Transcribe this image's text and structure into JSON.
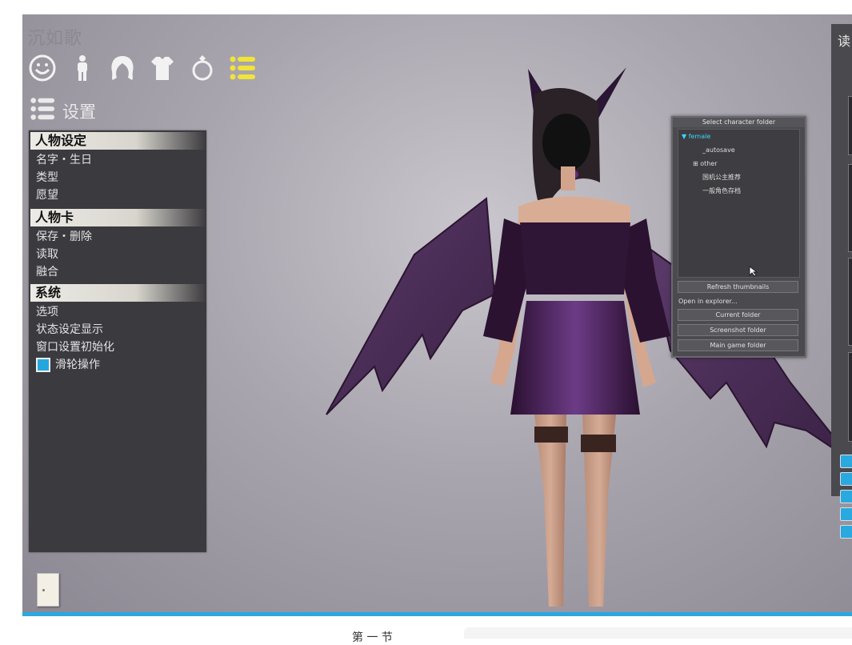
{
  "character": {
    "name": "沉如歌"
  },
  "categories": [
    {
      "icon": "face-icon",
      "label": "face"
    },
    {
      "icon": "body-icon",
      "label": "body"
    },
    {
      "icon": "hair-icon",
      "label": "hair"
    },
    {
      "icon": "clothes-icon",
      "label": "clothes"
    },
    {
      "icon": "accessory-ring-icon",
      "label": "accessory"
    },
    {
      "icon": "settings-list-icon",
      "label": "settings"
    }
  ],
  "settings_header": {
    "label": "设置"
  },
  "sections": {
    "character_settings": {
      "title": "人物设定",
      "items": [
        "名字・生日",
        "类型",
        "愿望"
      ]
    },
    "character_card": {
      "title": "人物卡",
      "items": [
        "保存・删除",
        "读取",
        "融合"
      ]
    },
    "system": {
      "title": "系统",
      "items": [
        "选项",
        "状态设定显示",
        "窗口设置初始化"
      ],
      "checkbox": {
        "label": "滑轮操作",
        "checked": true
      }
    }
  },
  "folder_dialog": {
    "title": "Select character folder",
    "tree": [
      {
        "label": "▼ female",
        "selected": true
      },
      {
        "label": "_autosave",
        "selected": false
      },
      {
        "label": "⊞ other",
        "selected": false
      },
      {
        "label": "国机公主推荐",
        "selected": false
      },
      {
        "label": "一般角色存档",
        "selected": false
      }
    ],
    "refresh": "Refresh thumbnails",
    "open_explorer": "Open in explorer...",
    "current_folder": "Current folder",
    "screenshot_folder": "Screenshot folder",
    "main_game_folder": "Main game folder"
  },
  "right_panel": {
    "title": "读"
  },
  "caption": "第 一 节",
  "colors": {
    "accent": "#2aa8e0",
    "selected_tree": "#3ad8ff",
    "icon_active": "#f0e33a",
    "panel": "#3b3a3e"
  }
}
